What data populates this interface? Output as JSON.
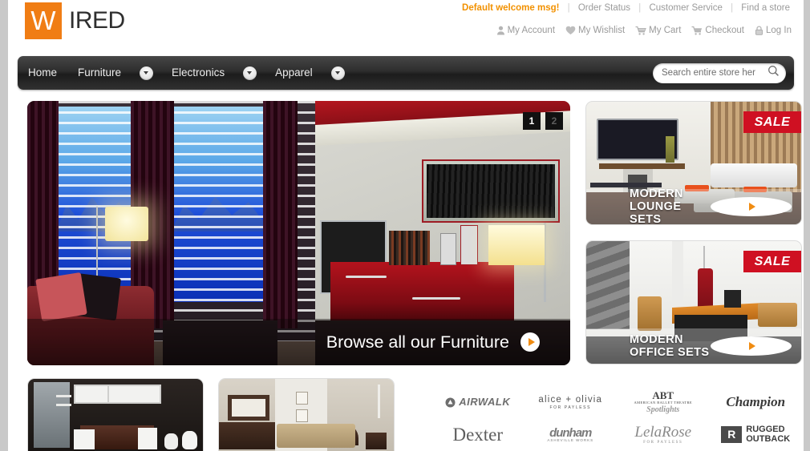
{
  "brand": {
    "logo_mark": "W",
    "logo_text": "IRED",
    "accent": "#f07d14"
  },
  "header": {
    "welcome": "Default welcome msg!",
    "links": [
      {
        "label": "Order Status"
      },
      {
        "label": "Customer Service"
      },
      {
        "label": "Find a store"
      }
    ],
    "account_links": [
      {
        "label": "My Account",
        "icon": "user-icon"
      },
      {
        "label": "My Wishlist",
        "icon": "heart-icon"
      },
      {
        "label": "My Cart",
        "icon": "cart-icon"
      },
      {
        "label": "Checkout",
        "icon": "checkout-cart-icon"
      },
      {
        "label": "Log In",
        "icon": "lock-icon"
      }
    ]
  },
  "nav": {
    "items": [
      {
        "label": "Home",
        "has_caret": false
      },
      {
        "label": "Furniture",
        "has_caret": true
      },
      {
        "label": "Electronics",
        "has_caret": true
      },
      {
        "label": "Apparel",
        "has_caret": true
      }
    ],
    "search": {
      "placeholder": "Search entire store her",
      "value": "",
      "icon": "search-icon"
    }
  },
  "hero": {
    "caption": "Browse all our Furniture",
    "pager": [
      {
        "label": "1",
        "active": true
      },
      {
        "label": "2",
        "active": false
      }
    ],
    "play_icon": "play-arrow-icon"
  },
  "promos": [
    {
      "title": "MODERN LOUNGE SETS",
      "badge": "SALE",
      "badge_color": "#cf1022",
      "play_icon": "play-arrow-icon"
    },
    {
      "title": "MODERN OFFICE SETS",
      "badge": "SALE",
      "badge_color": "#cf1022",
      "play_icon": "play-arrow-icon"
    }
  ],
  "tiles": [
    {
      "name": "bathroom-furniture-tile"
    },
    {
      "name": "bedroom-furniture-tile"
    }
  ],
  "brands": [
    {
      "name": "AIRWALK",
      "style": "airwalk"
    },
    {
      "name": "alice + olivia",
      "sub": "FOR PAYLESS",
      "style": "alice"
    },
    {
      "name": "ABT",
      "sub": "AMERICAN BALLET THEATRE",
      "tagline": "Spotlights",
      "style": "abt"
    },
    {
      "name": "Champion",
      "style": "champion"
    },
    {
      "name": "Dexter",
      "style": "dexter"
    },
    {
      "name": "dunham",
      "sub": "ASHEVILLE  WORKS",
      "style": "dunham"
    },
    {
      "name": "LelaRose",
      "sub": "FOR PAYLESS",
      "style": "lela"
    },
    {
      "name": "RUGGED OUTBACK",
      "mark": "R",
      "line1": "RUGGED",
      "line2": "OUTBACK",
      "style": "rugged"
    }
  ]
}
